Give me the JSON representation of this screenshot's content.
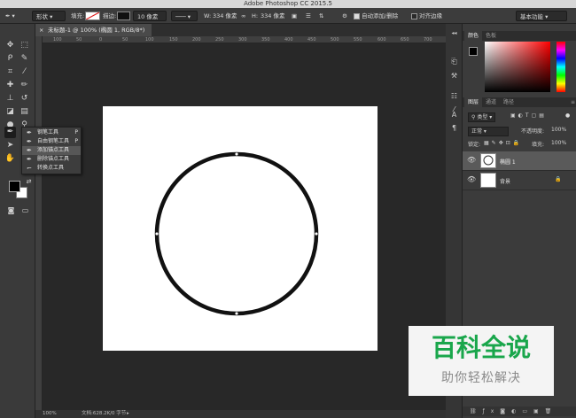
{
  "window": {
    "title": "Adobe Photoshop CC 2015.5"
  },
  "options": {
    "tool_mode": "形状",
    "fill_label": "填充:",
    "stroke_label": "描边:",
    "stroke_width": "10 像素",
    "w_label": "W:",
    "w_value": "334 像素",
    "h_label": "H:",
    "h_value": "334 像素",
    "auto_add_delete": "自动添加/删除",
    "align_edges": "对齐边缘",
    "workspace": "基本功能"
  },
  "document": {
    "tab_title": "未标题-1 @ 100% (椭圆 1, RGB/8*)",
    "ruler_numbers": [
      "100",
      "50",
      "0",
      "50",
      "100",
      "150",
      "200",
      "250",
      "300",
      "350",
      "400",
      "450",
      "500",
      "550",
      "600",
      "650",
      "700"
    ],
    "zoom": "100%",
    "doc_info": "文档:628.2K/0 字节"
  },
  "pen_flyout": {
    "items": [
      {
        "label": "钢笔工具",
        "key": "P"
      },
      {
        "label": "自由钢笔工具",
        "key": "P"
      },
      {
        "label": "添加锚点工具",
        "key": ""
      },
      {
        "label": "删除锚点工具",
        "key": ""
      },
      {
        "label": "转换点工具",
        "key": ""
      }
    ]
  },
  "color_panel": {
    "tabs": [
      "颜色",
      "色板"
    ]
  },
  "layers_panel": {
    "tabs": [
      "图层",
      "通道",
      "路径"
    ],
    "filter_label": "类型",
    "blend_mode": "正常",
    "opacity_label": "不透明度:",
    "opacity_value": "100%",
    "lock_label": "锁定:",
    "fill_label": "填充:",
    "fill_value": "100%",
    "layers": [
      {
        "name": "椭圆 1"
      },
      {
        "name": "背景"
      }
    ]
  },
  "watermark": {
    "brand": "百科全说",
    "slogan": "助你轻松解决"
  },
  "colors": {
    "watermark_green": "#19a64b",
    "stroke": "#111111"
  }
}
